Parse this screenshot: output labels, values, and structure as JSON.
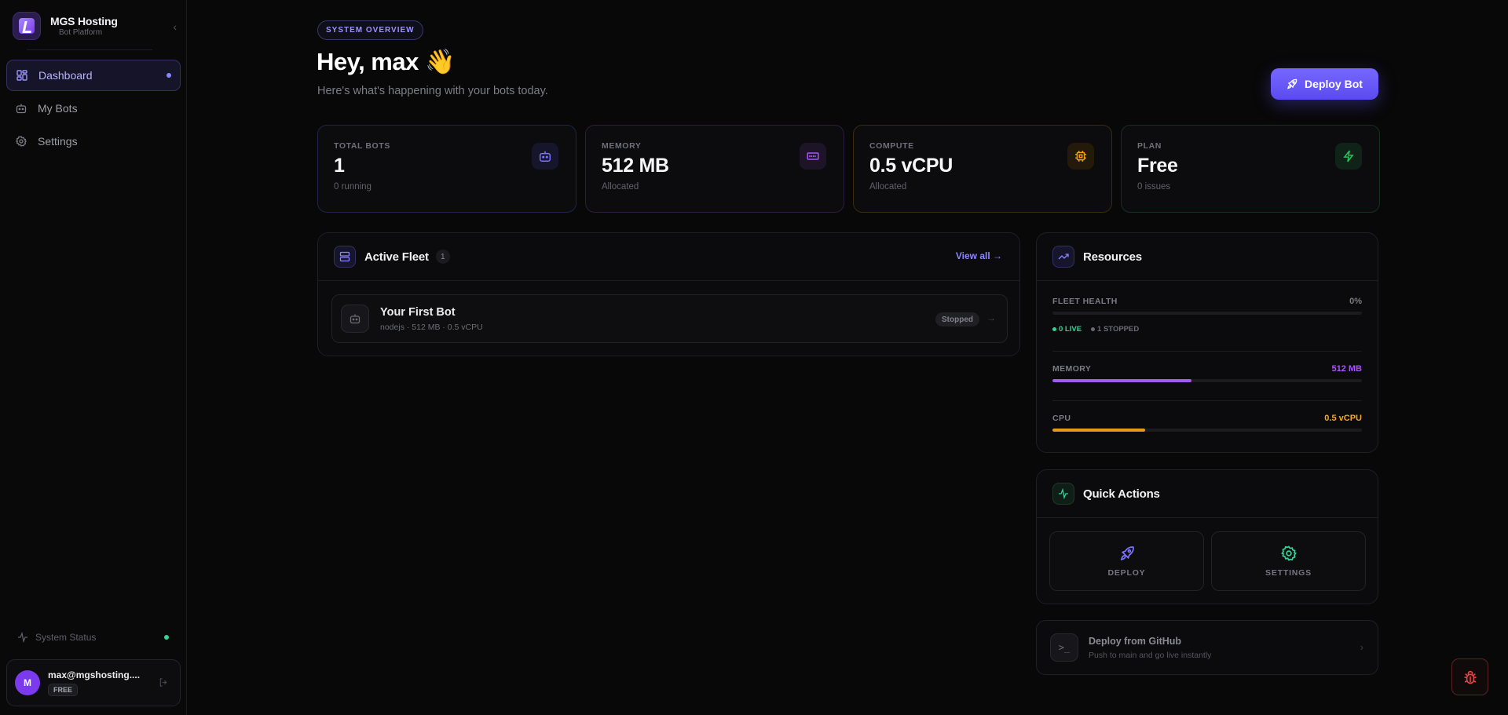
{
  "brand": {
    "title": "MGS Hosting",
    "subtitle": "Bot Platform"
  },
  "nav": {
    "items": [
      {
        "label": "Dashboard",
        "icon": "grid-icon",
        "active": true
      },
      {
        "label": "My Bots",
        "icon": "bot-icon"
      },
      {
        "label": "Settings",
        "icon": "gear-icon"
      }
    ]
  },
  "system_status": {
    "label": "System Status",
    "color": "#34d399"
  },
  "user": {
    "initial": "M",
    "email": "max@mgshosting....",
    "plan": "FREE"
  },
  "header": {
    "pill": "SYSTEM OVERVIEW",
    "greeting": "Hey, max 👋",
    "subtitle": "Here's what's happening with your bots today.",
    "deploy_label": "Deploy Bot"
  },
  "stats": [
    {
      "label": "TOTAL BOTS",
      "value": "1",
      "sub": "0 running",
      "icon": "bot-icon",
      "color": "#7c74ff"
    },
    {
      "label": "MEMORY",
      "value": "512 MB",
      "sub": "Allocated",
      "icon": "memory-icon",
      "color": "#a855f7"
    },
    {
      "label": "COMPUTE",
      "value": "0.5 vCPU",
      "sub": "Allocated",
      "icon": "cpu-icon",
      "color": "#f59e0b"
    },
    {
      "label": "PLAN",
      "value": "Free",
      "sub": "0 issues",
      "icon": "bolt-icon",
      "color": "#22c55e"
    }
  ],
  "fleet": {
    "title": "Active Fleet",
    "count": "1",
    "view_all": "View all →",
    "bots": [
      {
        "name": "Your First Bot",
        "meta": "nodejs · 512 MB · 0.5 vCPU",
        "status": "Stopped"
      }
    ]
  },
  "resources": {
    "title": "Resources",
    "fleet_health": {
      "label": "FLEET HEALTH",
      "value": "0%",
      "fraction": 0.0,
      "live": "0 LIVE",
      "stopped": "1 STOPPED"
    },
    "memory": {
      "label": "MEMORY",
      "value": "512 MB",
      "fraction": 0.45,
      "color": "#a855f7"
    },
    "cpu": {
      "label": "CPU",
      "value": "0.5 vCPU",
      "fraction": 0.3,
      "color": "#f59e0b"
    }
  },
  "quick_actions": {
    "title": "Quick Actions",
    "items": [
      {
        "label": "DEPLOY",
        "icon": "rocket-icon",
        "color": "#7c74ff"
      },
      {
        "label": "SETTINGS",
        "icon": "gear-icon",
        "color": "#34d399"
      }
    ]
  },
  "github": {
    "title": "Deploy from GitHub",
    "subtitle": "Push to main and go live instantly",
    "icon_text": ">_"
  },
  "bug_report": {
    "icon": "bug-icon",
    "color": "#ef4444"
  }
}
